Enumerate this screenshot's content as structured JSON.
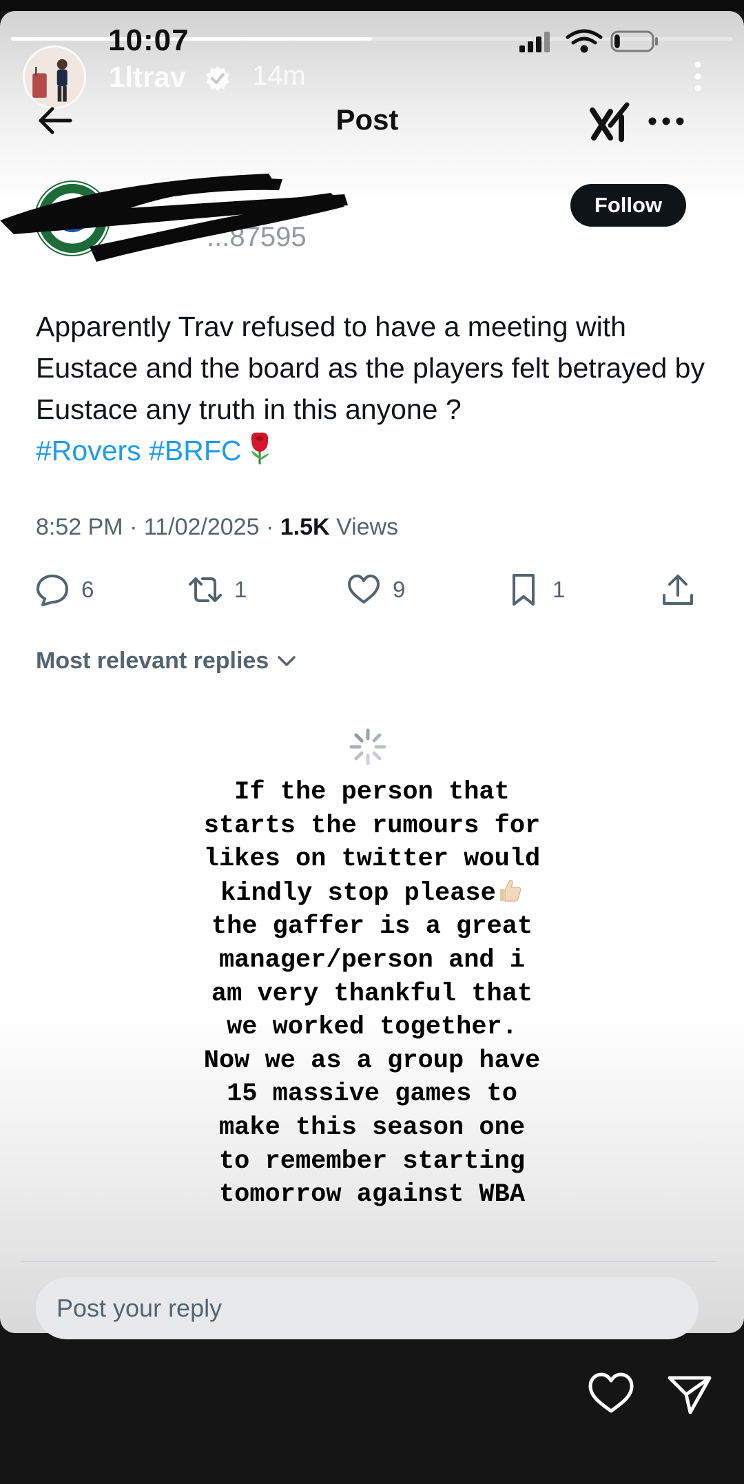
{
  "status_bar": {
    "time": "10:07",
    "battery_level": 0.15
  },
  "story": {
    "progress": 0.5,
    "username": "1ltrav",
    "verified": true,
    "time_ago": "14m",
    "menu_icon": "more-vertical-icon",
    "like_icon": "heart-outline-icon",
    "send_icon": "send-icon"
  },
  "post_view": {
    "header": {
      "title": "Post",
      "back_icon": "arrow-left-icon",
      "grok_icon": "grok-icon",
      "more_icon": "more-horizontal-icon"
    },
    "author": {
      "handle_fragment": "...87595",
      "follow_label": "Follow",
      "redacted": true
    },
    "body": {
      "text": "Apparently Trav refused to have a meeting with Eustace and the board as the players felt betrayed by Eustace any truth in this anyone ?",
      "hashtags": [
        "#Rovers",
        "#BRFC"
      ],
      "emoji": "rose"
    },
    "meta": {
      "time": "8:52 PM",
      "separator": "·",
      "date": "11/02/2025",
      "views_count": "1.5K",
      "views_label": "Views"
    },
    "actions": {
      "replies": "6",
      "reposts": "1",
      "likes": "9",
      "bookmarks": "1"
    },
    "replies_sort": "Most relevant replies",
    "reply_placeholder": "Post your reply"
  },
  "story_caption": {
    "lines": [
      "If the person that",
      "starts the rumours for",
      "likes on twitter would",
      "kindly stop please",
      "the gaffer is a great",
      "manager/person and i",
      "am very thankful that",
      "we worked together.",
      "Now we as a group have",
      "15 massive games to",
      "make this season one",
      "to remember starting",
      "tomorrow against WBA"
    ],
    "emoji_after_line_4": "thumbs-up"
  },
  "colors": {
    "accent": "#1d9bf0",
    "follow_bg": "#0f1419",
    "muted": "#536471"
  }
}
